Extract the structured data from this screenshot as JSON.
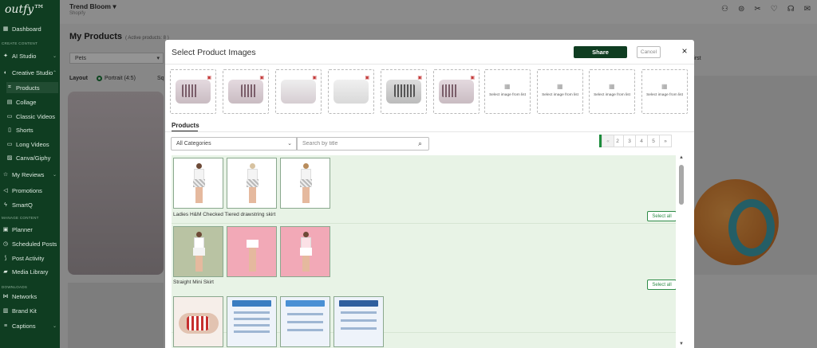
{
  "app": {
    "logo": "outfy™"
  },
  "sidebar": {
    "sections": [
      "CREATE CONTENT",
      "MANAGE CONTENT",
      "DOWNLOADS"
    ],
    "items": [
      {
        "label": "Dashboard",
        "icon": "dashboard-icon"
      },
      {
        "label": "AI Studio",
        "icon": "ai-icon"
      },
      {
        "label": "Creative Studio",
        "icon": "palette-icon"
      },
      {
        "label": "Products",
        "icon": "tag-icon"
      },
      {
        "label": "Collage",
        "icon": "grid-icon"
      },
      {
        "label": "Classic Videos",
        "icon": "video-icon"
      },
      {
        "label": "Shorts",
        "icon": "shorts-icon"
      },
      {
        "label": "Long Videos",
        "icon": "film-icon"
      },
      {
        "label": "Canva/Giphy",
        "icon": "gif-icon"
      },
      {
        "label": "My Reviews",
        "icon": "star-icon"
      },
      {
        "label": "Promotions",
        "icon": "megaphone-icon"
      },
      {
        "label": "SmartQ",
        "icon": "bolt-icon"
      },
      {
        "label": "Planner",
        "icon": "calendar-icon"
      },
      {
        "label": "Scheduled Posts",
        "icon": "clock-icon"
      },
      {
        "label": "Post Activity",
        "icon": "activity-icon"
      },
      {
        "label": "Media Library",
        "icon": "folder-icon"
      },
      {
        "label": "Networks",
        "icon": "network-icon"
      },
      {
        "label": "Brand Kit",
        "icon": "briefcase-icon"
      },
      {
        "label": "Captions",
        "icon": "caption-icon"
      }
    ]
  },
  "header": {
    "store": "Trend Bloom",
    "platform": "Shopify",
    "page_title": "My Products",
    "page_sub": "( Active products: 8 )",
    "filter": "Pets",
    "layout_label": "Layout",
    "portrait": "Portrait (4:5)",
    "square_partial": "Sq",
    "sort_partial": "First"
  },
  "modal": {
    "title": "Select Product Images",
    "share": "Share",
    "cancel": "Cancel",
    "close": "×",
    "placeholder_text": "Select image from list",
    "products_tab": "Products",
    "category": "All Categories",
    "search_placeholder": "Search by title",
    "pages": [
      "«",
      "1",
      "2",
      "3",
      "4",
      "5",
      "»"
    ],
    "active_page": "1",
    "select_all": "Select all",
    "groups": [
      {
        "name": "Ladies H&M Checked Tiered drawstring skirt"
      },
      {
        "name": "Straight Mini Skirt"
      }
    ]
  },
  "colors": {
    "sidebar": "#0f3d21",
    "share_button": "#0f3d21",
    "active_page": "#1c8c3c",
    "list_bg": "#e8f3e6"
  }
}
